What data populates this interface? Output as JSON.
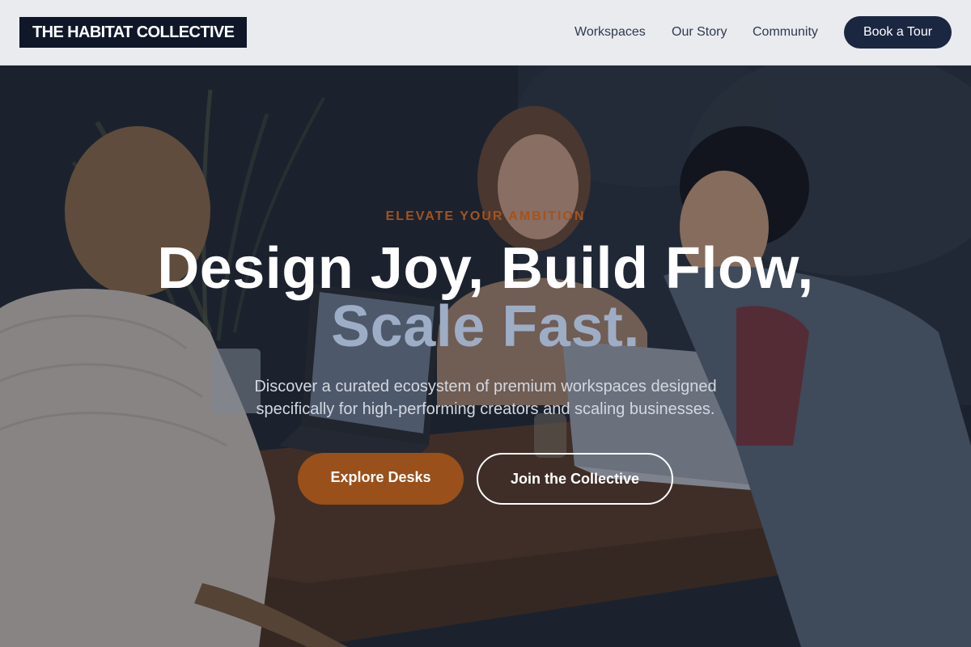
{
  "brand": {
    "name": "THE HABITAT COLLECTIVE"
  },
  "nav": {
    "links": [
      "Workspaces",
      "Our Story",
      "Community"
    ],
    "cta": "Book a Tour"
  },
  "hero": {
    "eyebrow": "ELEVATE YOUR AMBITION",
    "headline_line1": "Design Joy, Build Flow,",
    "headline_line2": "Scale Fast.",
    "subcopy": "Discover a curated ecosystem of premium workspaces designed specifically for high-performing creators and scaling businesses.",
    "primary_button": "Explore Desks",
    "secondary_button": "Join the Collective"
  },
  "colors": {
    "brand_dark": "#0f1729",
    "accent_orange": "#99501a",
    "headline_secondary": "#9eadc6"
  }
}
